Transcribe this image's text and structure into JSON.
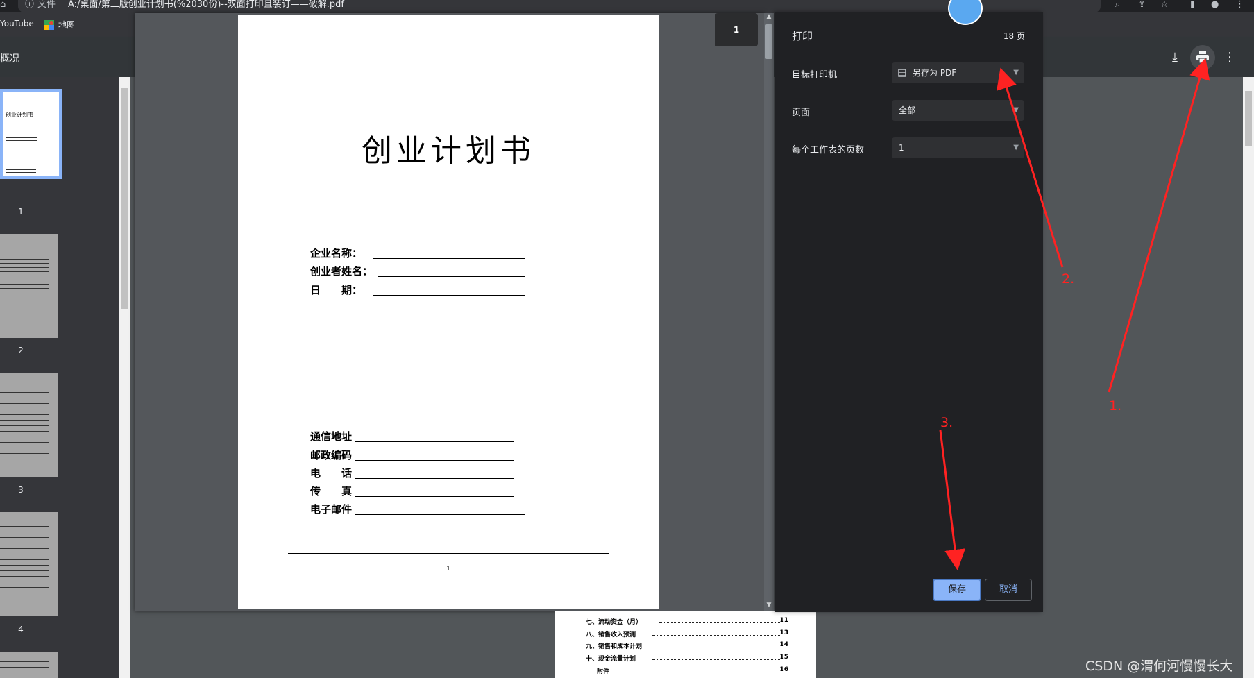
{
  "browser": {
    "info_label": "文件",
    "address": "A:/桌面/第二版创业计划书(%2030份)--双面打印且装订——破解.pdf",
    "bookmarks": [
      {
        "label": "YouTube",
        "icon": "youtube-icon"
      },
      {
        "label": "地图",
        "icon": "maps-icon"
      }
    ]
  },
  "pdf_viewer": {
    "sidebar_title": "概况",
    "current_page": "1",
    "thumbnails": [
      {
        "num": "1",
        "thumb_title": "创业计划书"
      },
      {
        "num": "2"
      },
      {
        "num": "3"
      },
      {
        "num": "4"
      }
    ],
    "page1": {
      "title": "创业计划书",
      "fields_top": [
        "企业名称：",
        "创业者姓名：",
        "日　　期："
      ],
      "fields_bottom": [
        "通信地址",
        "邮政编码",
        "电　　话",
        "传　　真",
        "电子邮件"
      ],
      "page_number": "1"
    },
    "page2_toc": [
      {
        "label": "七、流动资金（月）",
        "page": "11"
      },
      {
        "label": "八、销售收入预测",
        "page": "13"
      },
      {
        "label": "九、销售和成本计划",
        "page": "14"
      },
      {
        "label": "十、现金流量计划",
        "page": "15"
      },
      {
        "label": "附件",
        "page": "16"
      }
    ]
  },
  "print_dialog": {
    "title": "打印",
    "page_count": "18 页",
    "rows": [
      {
        "label": "目标打印机",
        "value": "另存为 PDF"
      },
      {
        "label": "页面",
        "value": "全部"
      },
      {
        "label": "每个工作表的页数",
        "value": "1"
      }
    ],
    "save_label": "保存",
    "cancel_label": "取消"
  },
  "annotations": {
    "step1": "1.",
    "step2": "2.",
    "step3": "3.",
    "color": "#ff2222"
  },
  "watermark": "CSDN @渭何河慢慢长大"
}
